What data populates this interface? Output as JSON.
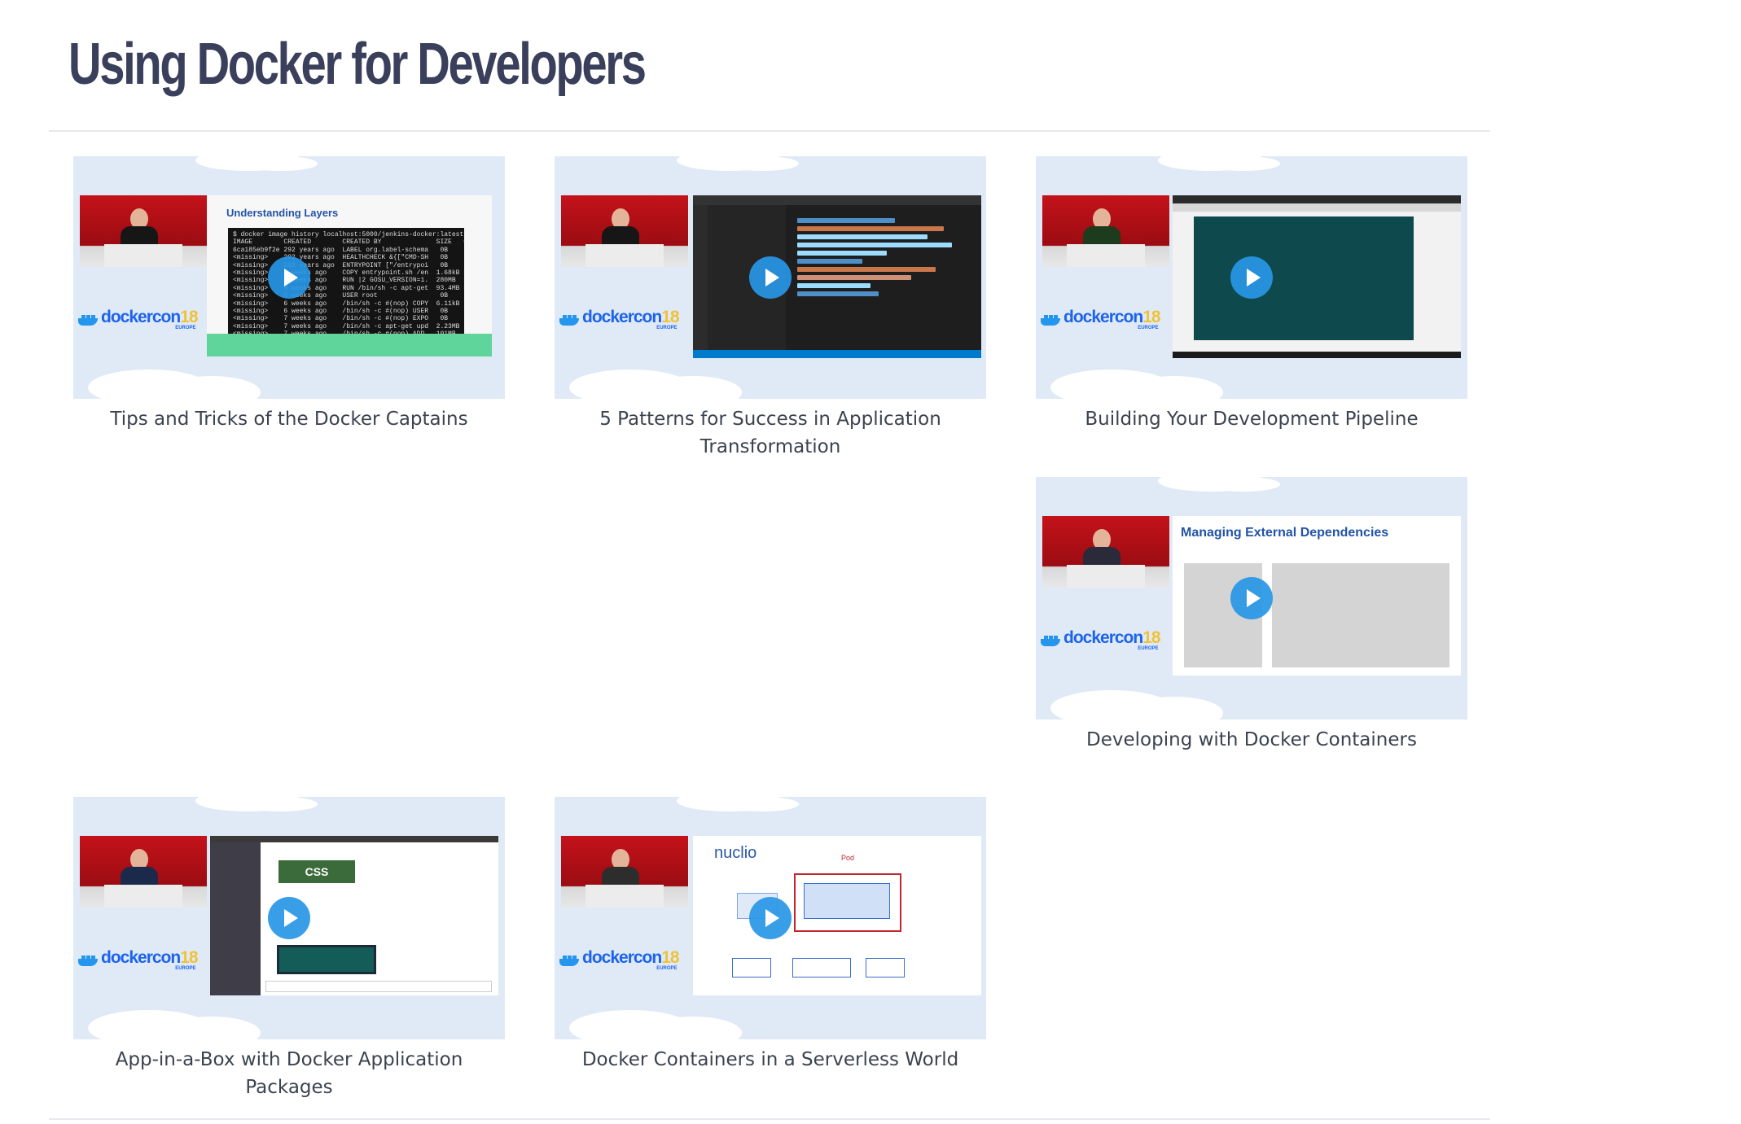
{
  "page": {
    "title": "Using Docker for Developers"
  },
  "brand": {
    "word": "dockercon",
    "year": "18",
    "region": "EUROPE"
  },
  "videos": [
    {
      "caption": "Tips and Tricks of the Docker Captains",
      "slide_title": "Understanding Layers",
      "slide_header": "$ docker image history localhost:5000/jenkins-docker:latest"
    },
    {
      "caption": "5 Patterns for Success in Application Transformation"
    },
    {
      "caption": "Building Your Development Pipeline"
    },
    {
      "caption": "Developing with Docker Containers",
      "slide_title": "Managing External Dependencies"
    },
    {
      "caption": "App-in-a-Box with Docker Application Packages",
      "slide_text": "CSS"
    },
    {
      "caption": "Docker Containers in a Serverless World",
      "slide_logo": "nuclio",
      "slide_text": "Pod"
    }
  ],
  "colors": {
    "title": "#3a3f5c",
    "thumb_bg": "#dfeaf6",
    "play": "#2496ed",
    "caption": "#3b4350"
  }
}
